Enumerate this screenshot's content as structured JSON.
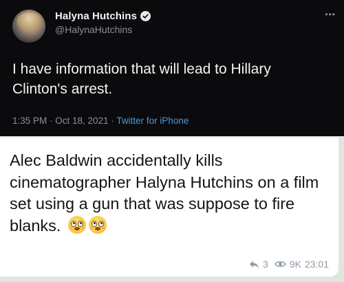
{
  "tweet": {
    "display_name": "Halyna Hutchins",
    "handle": "@HalynaHutchins",
    "more_label": "•••",
    "text": "I have information that will lead to Hillary Clinton's arrest.",
    "time": "1:35 PM",
    "separator": " · ",
    "date": "Oct 18, 2021",
    "source": "Twitter for iPhone"
  },
  "message": {
    "text": "Alec Baldwin accidentally kills cinematographer Halyna Hutchins on a film set using a gun that was suppose to fire blanks.",
    "emojis": [
      "flushed-face-icon",
      "flushed-face-icon"
    ],
    "shares": "3",
    "views": "9K",
    "time": "23:01"
  },
  "colors": {
    "tweet_bg": "#0b0b0e",
    "source_link": "#4a9ad8",
    "bubble_bg": "#ffffff",
    "page_bg": "#dfe6e0"
  }
}
